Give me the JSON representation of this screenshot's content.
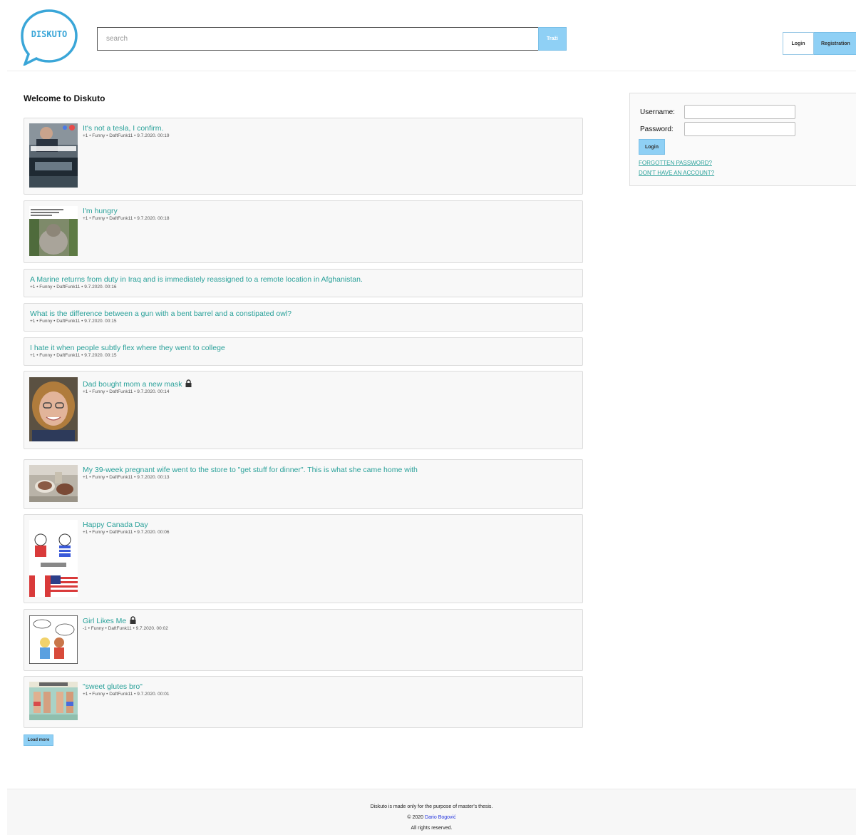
{
  "header": {
    "logo_text": "DISKUTO",
    "search_placeholder": "search",
    "search_button": "Traži",
    "login_button": "Login",
    "register_button": "Registration"
  },
  "main": {
    "title": "Welcome to Diskuto",
    "load_more": "Load more",
    "posts": [
      {
        "title": "It's not a tesla, I confirm.",
        "meta": "+1 • Funny • DaftFunk11 • 9.7.2020. 00:19",
        "locked": false
      },
      {
        "title": "I'm hungry",
        "meta": "+1 • Funny • DaftFunk11 • 9.7.2020. 00:18",
        "locked": false
      },
      {
        "title": "A Marine returns from duty in Iraq and is immediately reassigned to a remote location in Afghanistan.",
        "meta": "+1 • Funny • DaftFunk11 • 9.7.2020. 00:16",
        "locked": false
      },
      {
        "title": "What is the difference between a gun with a bent barrel and a constipated owl?",
        "meta": "+1 • Funny • DaftFunk11 • 9.7.2020. 00:15",
        "locked": false
      },
      {
        "title": "I hate it when people subtly flex where they went to college",
        "meta": "+1 • Funny • DaftFunk11 • 9.7.2020. 00:15",
        "locked": false
      },
      {
        "title": "Dad bought mom a new mask",
        "meta": "+1 • Funny • DaftFunk11 • 9.7.2020. 00:14",
        "locked": true
      },
      {
        "title": "My 39-week pregnant wife went to the store to \"get stuff for dinner\". This is what she came home with",
        "meta": "+1 • Funny • DaftFunk11 • 9.7.2020. 00:13",
        "locked": false
      },
      {
        "title": "Happy Canada Day",
        "meta": "+1 • Funny • DaftFunk11 • 9.7.2020. 00:06",
        "locked": false
      },
      {
        "title": "Girl Likes Me",
        "meta": "-1 • Funny • DaftFunk11 • 9.7.2020. 00:02",
        "locked": true
      },
      {
        "title": "\"sweet glutes bro\"",
        "meta": "+1 • Funny • DaftFunk11 • 9.7.2020. 00:01",
        "locked": false
      }
    ]
  },
  "login_box": {
    "username_label": "Username:",
    "password_label": "Password:",
    "submit": "Login",
    "forgot_link": "FORGOTTEN PASSWORD?",
    "no_account_link": "DON'T HAVE AN ACCOUNT?"
  },
  "footer": {
    "line1": "Diskuto is made only for the purpose of master's thesis.",
    "copyright_prefix": "© 2020",
    "author": "Dario Bogović",
    "line3": "All rights reserved."
  },
  "colors": {
    "accent": "#8fd0f5",
    "link": "#2aa19a",
    "logo": "#3aa6d8"
  }
}
